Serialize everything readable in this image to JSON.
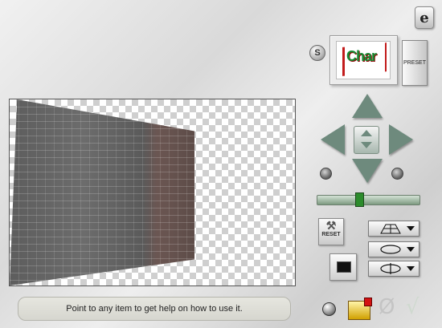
{
  "header": {
    "logo_label": "e",
    "s_label": "S"
  },
  "preset": {
    "preview_label": "Char",
    "tab_label": "PRESET"
  },
  "controls": {
    "reset_label": "RESET"
  },
  "footer": {
    "help_text": "Point to any item to get help on how to use it."
  },
  "actions": {
    "cancel_glyph": "Ø",
    "ok_glyph": "√"
  }
}
